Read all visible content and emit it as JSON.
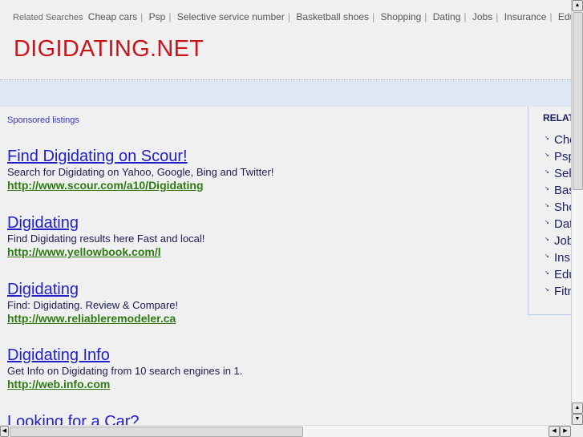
{
  "top_bar": {
    "label": "Related Searches",
    "links": [
      "Cheap cars",
      "Psp",
      "Selective service number",
      "Basketball shoes",
      "Shopping",
      "Dating",
      "Jobs",
      "Insurance",
      "Edu"
    ]
  },
  "site_title": "DIGIDATING.NET",
  "sponsored_label": "Sponsored listings",
  "ads": [
    {
      "title": "Find Digidating on Scour!",
      "desc": "Search for Digidating on Yahoo, Google, Bing and Twitter!",
      "url": "http://www.scour.com/a10/Digidating"
    },
    {
      "title": "Digidating",
      "desc": "Find Digidating results here Fast and local!",
      "url": "http://www.yellowbook.com/l"
    },
    {
      "title": "Digidating",
      "desc": "Find: Digidating. Review & Compare!",
      "url": "http://www.reliableremodeler.ca"
    },
    {
      "title": "Digidating Info",
      "desc": "Get Info on Digidating from 10 search engines in 1.",
      "url": "http://web.info.com"
    },
    {
      "title": "Looking for a Car?",
      "desc": "",
      "url": ""
    }
  ],
  "sidebar": {
    "heading": "RELAT",
    "items": [
      "Che",
      "Psp",
      "Sel",
      "Bas",
      "Sho",
      "Dat",
      "Job",
      "Insu",
      "Edu",
      "Fitn"
    ]
  }
}
